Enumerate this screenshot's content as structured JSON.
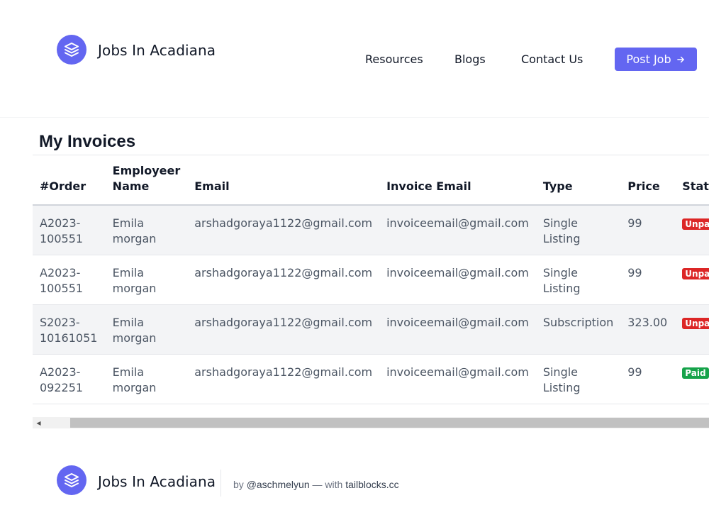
{
  "brand": {
    "name": "Jobs In Acadiana",
    "accent_color": "#6366f1",
    "icon": "layers-icon"
  },
  "nav": {
    "links": [
      "Resources",
      "Blogs",
      "Contact Us"
    ],
    "post_job": "Post Job",
    "post_job_icon": "arrow-right-icon"
  },
  "page": {
    "title": "My Invoices"
  },
  "table": {
    "headers": {
      "order": "#Order",
      "employer_line1": "Employeer",
      "employer_line2": "Name",
      "email": "Email",
      "invoice_email": "Invoice Email",
      "type": "Type",
      "price": "Price",
      "status": "Status"
    },
    "rows": [
      {
        "order_a": "A2023-",
        "order_b": "100551",
        "name_a": "Emila",
        "name_b": "morgan",
        "email": "arshadgoraya1122@gmail.com",
        "invoice_email": "invoiceemail@gmail.com",
        "type_a": "Single",
        "type_b": "Listing",
        "price": "99",
        "status": "Unpaid"
      },
      {
        "order_a": "A2023-",
        "order_b": "100551",
        "name_a": "Emila",
        "name_b": "morgan",
        "email": "arshadgoraya1122@gmail.com",
        "invoice_email": "invoiceemail@gmail.com",
        "type_a": "Single",
        "type_b": "Listing",
        "price": "99",
        "status": "Unpaid"
      },
      {
        "order_a": "S2023-",
        "order_b": "10161051",
        "name_a": "Emila",
        "name_b": "morgan",
        "email": "arshadgoraya1122@gmail.com",
        "invoice_email": "invoiceemail@gmail.com",
        "type_a": "Subscription",
        "type_b": "",
        "price": "323.00",
        "status": "Unpaid"
      },
      {
        "order_a": "A2023-",
        "order_b": "092251",
        "name_a": "Emila",
        "name_b": "morgan",
        "email": "arshadgoraya1122@gmail.com",
        "invoice_email": "invoiceemail@gmail.com",
        "type_a": "Single",
        "type_b": "Listing",
        "price": "99",
        "status": "Paid"
      }
    ],
    "status_colors": {
      "Unpaid": "#dc2626",
      "Paid": "#16a34a"
    }
  },
  "footer": {
    "brand": "Jobs In Acadiana",
    "credit_prefix": "by",
    "credit_handle": "@aschmelyun",
    "credit_mid": "— with",
    "credit_site": "tailblocks.cc"
  }
}
